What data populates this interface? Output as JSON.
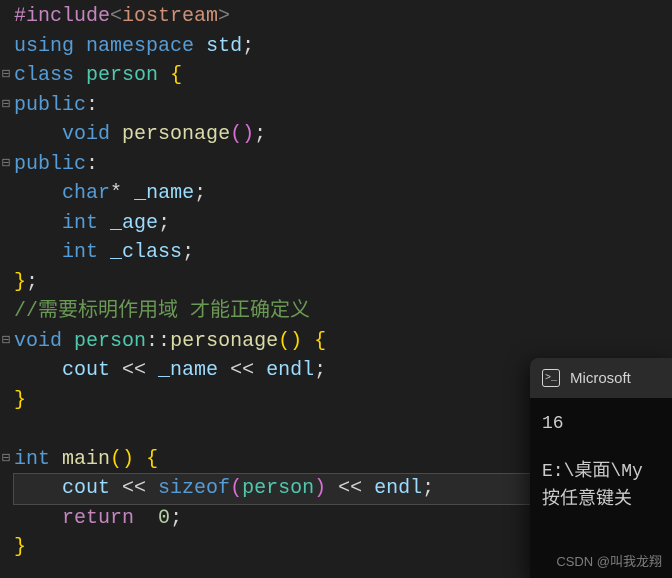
{
  "code": {
    "line1": {
      "include": "#include",
      "open": "<",
      "header": "iostream",
      "close": ">"
    },
    "line2": {
      "using": "using",
      "namespace": "namespace",
      "std": "std",
      "semi": ";"
    },
    "line3": {
      "class": "class",
      "name": "person",
      "brace": "{"
    },
    "line4": {
      "public": "public",
      "colon": ":"
    },
    "line5": {
      "indent": "    ",
      "void": "void",
      "func": "personage",
      "parens": "()",
      "semi": ";"
    },
    "line6": {
      "public": "public",
      "colon": ":"
    },
    "line7": {
      "indent": "    ",
      "char": "char",
      "star": "*",
      "name": "_name",
      "semi": ";"
    },
    "line8": {
      "indent": "    ",
      "int": "int",
      "name": "_age",
      "semi": ";"
    },
    "line9": {
      "indent": "    ",
      "int": "int",
      "name": "_class",
      "semi": ";"
    },
    "line10": {
      "brace": "}",
      "semi": ";"
    },
    "line11": {
      "comment": "//需要标明作用域 才能正确定义"
    },
    "line12": {
      "void": "void",
      "cls": "person",
      "scope": "::",
      "func": "personage",
      "parens": "()",
      "brace": " {"
    },
    "line13": {
      "indent": "    ",
      "cout": "cout",
      "op1": " << ",
      "name": "_name",
      "op2": " << ",
      "endl": "endl",
      "semi": ";"
    },
    "line14": {
      "brace": "}"
    },
    "line15": "",
    "line16": {
      "int": "int",
      "main": "main",
      "parens": "()",
      "brace": " {"
    },
    "line17": {
      "indent": "    ",
      "cout": "cout",
      "op1": " << ",
      "sizeof": "sizeof",
      "po": "(",
      "cls": "person",
      "pc": ")",
      "op2": " << ",
      "endl": "endl",
      "semi": ";"
    },
    "line18": {
      "indent": "    ",
      "return": "return",
      "sp": "  ",
      "zero": "0",
      "semi": ";"
    },
    "line19": {
      "brace": "}"
    }
  },
  "folds": [
    "",
    "",
    "⊟",
    "⊟",
    "",
    "⊟",
    "",
    "",
    "",
    "",
    "",
    "⊟",
    "",
    "",
    "",
    "⊟",
    "",
    "",
    ""
  ],
  "console": {
    "title": "Microsoft",
    "out1": "16",
    "out2": "E:\\桌面\\My",
    "out3": "按任意键关"
  },
  "watermark": "CSDN @叫我龙翔"
}
